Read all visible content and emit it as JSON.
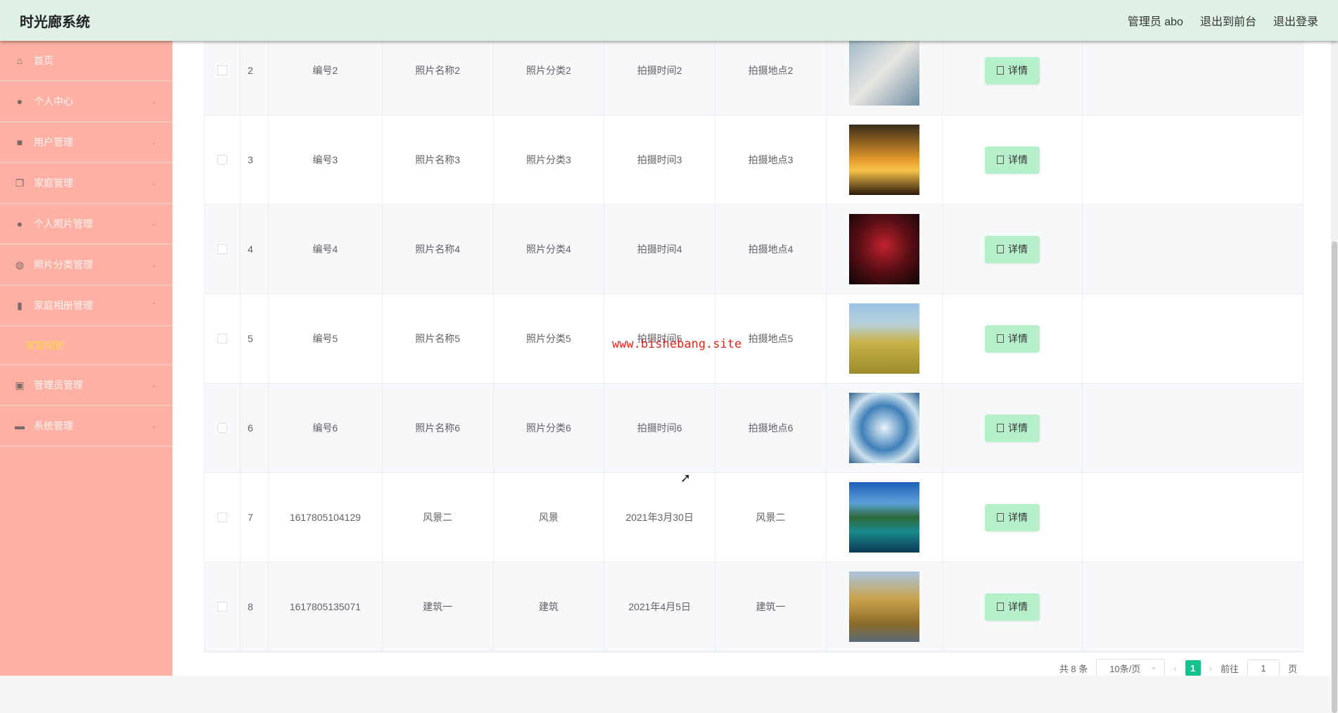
{
  "header": {
    "title": "时光廊系统",
    "user": "管理员 abo",
    "to_front": "退出到前台",
    "logout": "退出登录"
  },
  "sidebar": {
    "items": [
      {
        "label": "首页",
        "icon": "home-icon",
        "glyph": "⌂",
        "chev": ""
      },
      {
        "label": "个人中心",
        "icon": "user-icon",
        "glyph": "●",
        "chev": "⌄"
      },
      {
        "label": "用户管理",
        "icon": "book-icon",
        "glyph": "■",
        "chev": "⌄"
      },
      {
        "label": "家庭管理",
        "icon": "copy-icon",
        "glyph": "❐",
        "chev": "⌄"
      },
      {
        "label": "个人照片管理",
        "icon": "user-icon",
        "glyph": "●",
        "chev": "⌄"
      },
      {
        "label": "照片分类管理",
        "icon": "globe-icon",
        "glyph": "◍",
        "chev": "⌄"
      },
      {
        "label": "家庭相册管理",
        "icon": "album-icon",
        "glyph": "▮",
        "chev": "⌃"
      }
    ],
    "sub_item": "家庭相册",
    "items2": [
      {
        "label": "管理员管理",
        "icon": "chart-icon",
        "glyph": "▣",
        "chev": "⌄"
      },
      {
        "label": "系统管理",
        "icon": "briefcase-icon",
        "glyph": "▬",
        "chev": "⌄"
      }
    ]
  },
  "table": {
    "detail_label": "详情",
    "rows": [
      {
        "idx": "2",
        "no": "编号2",
        "name": "照片名称2",
        "cat": "照片分类2",
        "time": "拍摄时间2",
        "place": "拍摄地点2",
        "img": "linear-gradient(135deg,#9db7c9,#e8e6e2 50%,#6f8ea3)"
      },
      {
        "idx": "3",
        "no": "编号3",
        "name": "照片名称3",
        "cat": "照片分类3",
        "time": "拍摄时间3",
        "place": "拍摄地点3",
        "img": "linear-gradient(180deg,#3a2a1a,#e39a2b 50%,#f7c34a 65%,#2b1a0c)"
      },
      {
        "idx": "4",
        "no": "编号4",
        "name": "照片名称4",
        "cat": "照片分类4",
        "time": "拍摄时间4",
        "place": "拍摄地点4",
        "img": "radial-gradient(circle at 50% 45%,#c0222e,#5a0e14 50%,#0b0607)"
      },
      {
        "idx": "5",
        "no": "编号5",
        "name": "照片名称5",
        "cat": "照片分类5",
        "time": "拍摄时间5",
        "place": "拍摄地点5",
        "img": "linear-gradient(180deg,#9cc3e6 0%,#b7cfd8 30%,#c9b34a 55%,#9a8a2a)"
      },
      {
        "idx": "6",
        "no": "编号6",
        "name": "照片名称6",
        "cat": "照片分类6",
        "time": "拍摄时间6",
        "place": "拍摄地点6",
        "img": "radial-gradient(circle at 50% 50%,#e9f4fb,#3f7fb8 45%,#cde1ee 70%,#2a5f8d)"
      },
      {
        "idx": "7",
        "no": "1617805104129",
        "name": "风景二",
        "cat": "风景",
        "time": "2021年3月30日",
        "place": "风景二",
        "img": "linear-gradient(180deg,#1d5fb8,#5da0d8 30%,#2f6a3a 50%,#1a8a8c 70%,#0c3a55)"
      },
      {
        "idx": "8",
        "no": "1617805135071",
        "name": "建筑一",
        "cat": "建筑",
        "time": "2021年4月5日",
        "place": "建筑一",
        "img": "linear-gradient(180deg,#a9c4df,#c9a24a 40%,#8a6a2a 75%,#5a6a78)"
      }
    ]
  },
  "pagination": {
    "total": "共 8 条",
    "page_size": "10条/页",
    "current": "1",
    "goto": "前往",
    "goto_value": "1",
    "page_unit": "页"
  },
  "watermark": "www.bishebang.site"
}
